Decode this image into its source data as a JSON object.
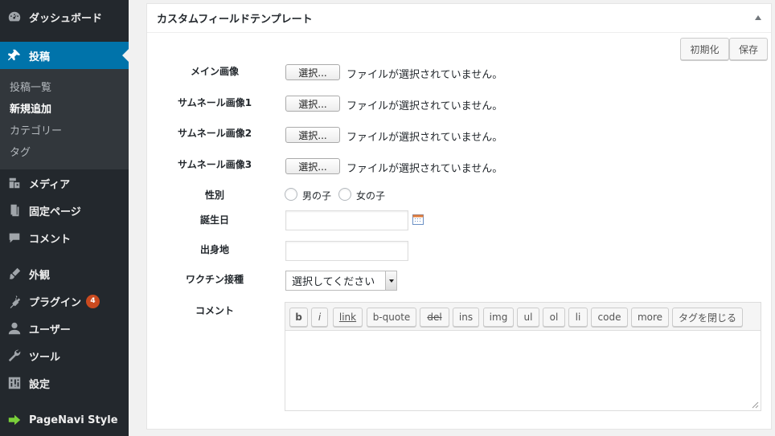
{
  "sidebar": {
    "items": [
      {
        "label": "ダッシュボード",
        "icon": "dashboard-icon"
      },
      {
        "label": "投稿",
        "icon": "pin-icon"
      },
      {
        "label": "メディア",
        "icon": "media-icon"
      },
      {
        "label": "固定ページ",
        "icon": "page-icon"
      },
      {
        "label": "コメント",
        "icon": "comment-icon"
      },
      {
        "label": "外観",
        "icon": "brush-icon"
      },
      {
        "label": "プラグイン",
        "icon": "plugin-icon",
        "badge": "4"
      },
      {
        "label": "ユーザー",
        "icon": "user-icon"
      },
      {
        "label": "ツール",
        "icon": "wrench-icon"
      },
      {
        "label": "設定",
        "icon": "settings-icon"
      },
      {
        "label": "PageNavi Style",
        "icon": "arrow-right-icon"
      }
    ],
    "submenu": [
      "投稿一覧",
      "新規追加",
      "カテゴリー",
      "タグ"
    ]
  },
  "panel": {
    "title": "カスタムフィールドテンプレート",
    "reset_label": "初期化",
    "save_label": "保存",
    "file_button_label": "選択...",
    "no_file_text": "ファイルが選択されていません。",
    "fields": {
      "main_image": "メイン画像",
      "thumb1": "サムネール画像1",
      "thumb2": "サムネール画像2",
      "thumb3": "サムネール画像3",
      "gender": "性別",
      "birthday": "誕生日",
      "birthplace": "出身地",
      "vaccine": "ワクチン接種",
      "comment": "コメント"
    },
    "gender_options": [
      "男の子",
      "女の子"
    ],
    "vaccine_selected": "選択してください",
    "birthday_value": "",
    "birthplace_value": "",
    "comment_value": "",
    "quicktags": [
      "b",
      "i",
      "link",
      "b-quote",
      "del",
      "ins",
      "img",
      "ul",
      "ol",
      "li",
      "code",
      "more",
      "タグを閉じる"
    ]
  },
  "colors": {
    "sidebar_bg": "#23282d",
    "submenu_bg": "#32373c",
    "active_bg": "#0073aa",
    "badge_bg": "#ca4a1f",
    "pagenavi_icon": "#7ad03a"
  }
}
